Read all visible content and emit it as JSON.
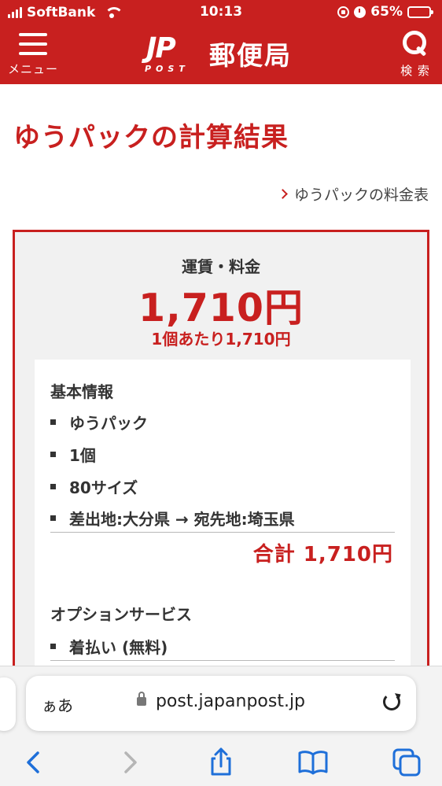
{
  "status_bar": {
    "carrier": "SoftBank",
    "time": "10:13",
    "battery": "65%",
    "battery_level": 0.65
  },
  "header": {
    "menu_label": "メニュー",
    "logo_mark": "JP",
    "logo_post": "POST",
    "brand_name": "郵便局",
    "search_label": "検 索"
  },
  "page": {
    "title": "ゆうパックの計算結果",
    "rate_table_link": "ゆうパックの料金表"
  },
  "result": {
    "fee_label": "運賃・料金",
    "fee_amount": "1,710円",
    "per_item": "1個あたり1,710円"
  },
  "basic_info": {
    "title": "基本情報",
    "items": [
      "ゆうパック",
      "1個",
      "80サイズ",
      "差出地:大分県 → 宛先地:埼玉県"
    ],
    "total": "合計 1,710円"
  },
  "options": {
    "title": "オプションサービス",
    "items": [
      "着払い (無料)"
    ]
  },
  "browser": {
    "aa_label": "ぁあ",
    "url": "post.japanpost.jp"
  },
  "colors": {
    "brand_red": "#c8201f",
    "safari_blue": "#1e6fd9"
  }
}
